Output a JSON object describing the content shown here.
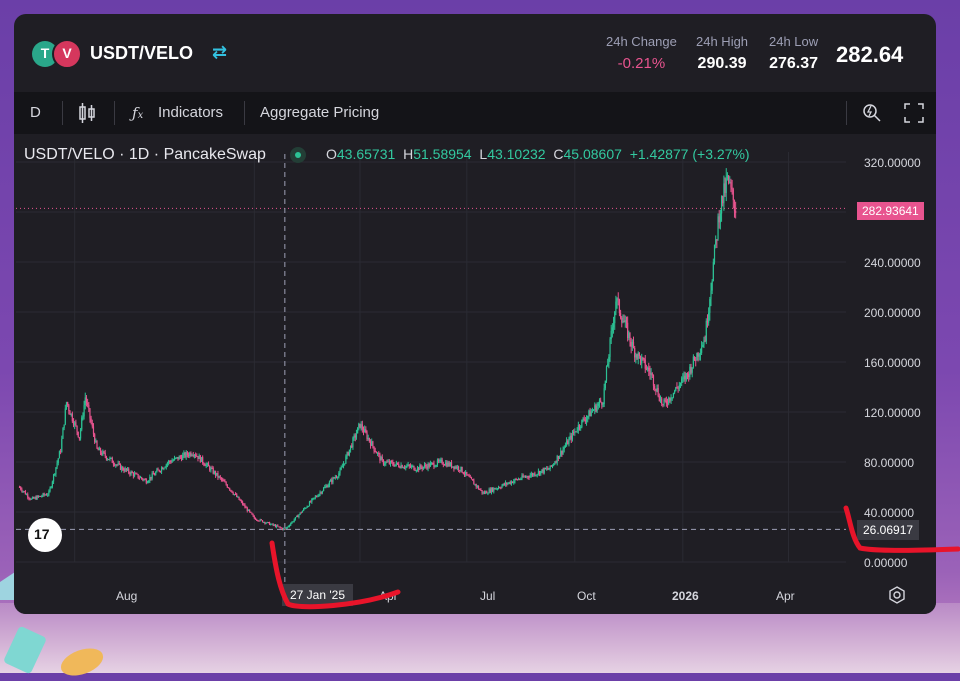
{
  "header": {
    "pair": "USDT/VELO",
    "logo1_glyph": "T",
    "logo2_glyph": "V",
    "stats": [
      {
        "label": "24h Change",
        "value": "-0.21%"
      },
      {
        "label": "24h High",
        "value": "290.39"
      },
      {
        "label": "24h Low",
        "value": "276.37"
      }
    ],
    "price": "282.64"
  },
  "toolbar": {
    "interval": "D",
    "indicators_label": "Indicators",
    "aggregate_label": "Aggregate Pricing"
  },
  "chart": {
    "legend_title": "USDT/VELO · 1D · PancakeSwap",
    "ohlc": {
      "o_label": "O",
      "o": "43.65731",
      "h_label": "H",
      "h": "51.58954",
      "l_label": "L",
      "l": "43.10232",
      "c_label": "C",
      "c": "45.08607",
      "change": "+1.42877 (+3.27%)"
    },
    "current_price_tag": "282.93641",
    "crosshair_price_tag": "26.06917",
    "crosshair_date_tag": "27 Jan '25",
    "tv_logo": "17"
  },
  "chart_data": {
    "type": "candlestick",
    "y_ticks": [
      "320.00000",
      "240.00000",
      "200.00000",
      "160.00000",
      "120.00000",
      "80.00000",
      "40.00000",
      "0.00000"
    ],
    "x_ticks": [
      "Aug",
      "Apr",
      "Jul",
      "Oct",
      "2026",
      "Apr"
    ],
    "ylim": [
      0,
      320
    ],
    "series_points": [
      [
        "2024-06-15",
        60
      ],
      [
        "2024-06-25",
        50
      ],
      [
        "2024-07-10",
        55
      ],
      [
        "2024-07-20",
        90
      ],
      [
        "2024-07-25",
        128
      ],
      [
        "2024-08-05",
        100
      ],
      [
        "2024-08-10",
        132
      ],
      [
        "2024-08-20",
        90
      ],
      [
        "2024-09-10",
        75
      ],
      [
        "2024-10-01",
        65
      ],
      [
        "2024-10-20",
        80
      ],
      [
        "2024-11-10",
        88
      ],
      [
        "2024-12-10",
        60
      ],
      [
        "2025-01-01",
        35
      ],
      [
        "2025-01-27",
        26
      ],
      [
        "2025-02-20",
        50
      ],
      [
        "2025-03-15",
        72
      ],
      [
        "2025-04-01",
        110
      ],
      [
        "2025-04-20",
        80
      ],
      [
        "2025-05-20",
        75
      ],
      [
        "2025-06-10",
        80
      ],
      [
        "2025-06-25",
        75
      ],
      [
        "2025-07-15",
        55
      ],
      [
        "2025-08-10",
        65
      ],
      [
        "2025-09-10",
        75
      ],
      [
        "2025-10-05",
        110
      ],
      [
        "2025-10-25",
        130
      ],
      [
        "2025-11-05",
        210
      ],
      [
        "2025-11-20",
        170
      ],
      [
        "2025-12-05",
        150
      ],
      [
        "2025-12-15",
        125
      ],
      [
        "2026-01-05",
        150
      ],
      [
        "2026-01-20",
        180
      ],
      [
        "2026-02-01",
        280
      ],
      [
        "2026-02-08",
        305
      ],
      [
        "2026-02-15",
        283
      ]
    ]
  },
  "annotation_color": "#e8142a",
  "colors": {
    "up": "#2cc194",
    "down": "#e8548f",
    "price_line": "#e8548f"
  }
}
